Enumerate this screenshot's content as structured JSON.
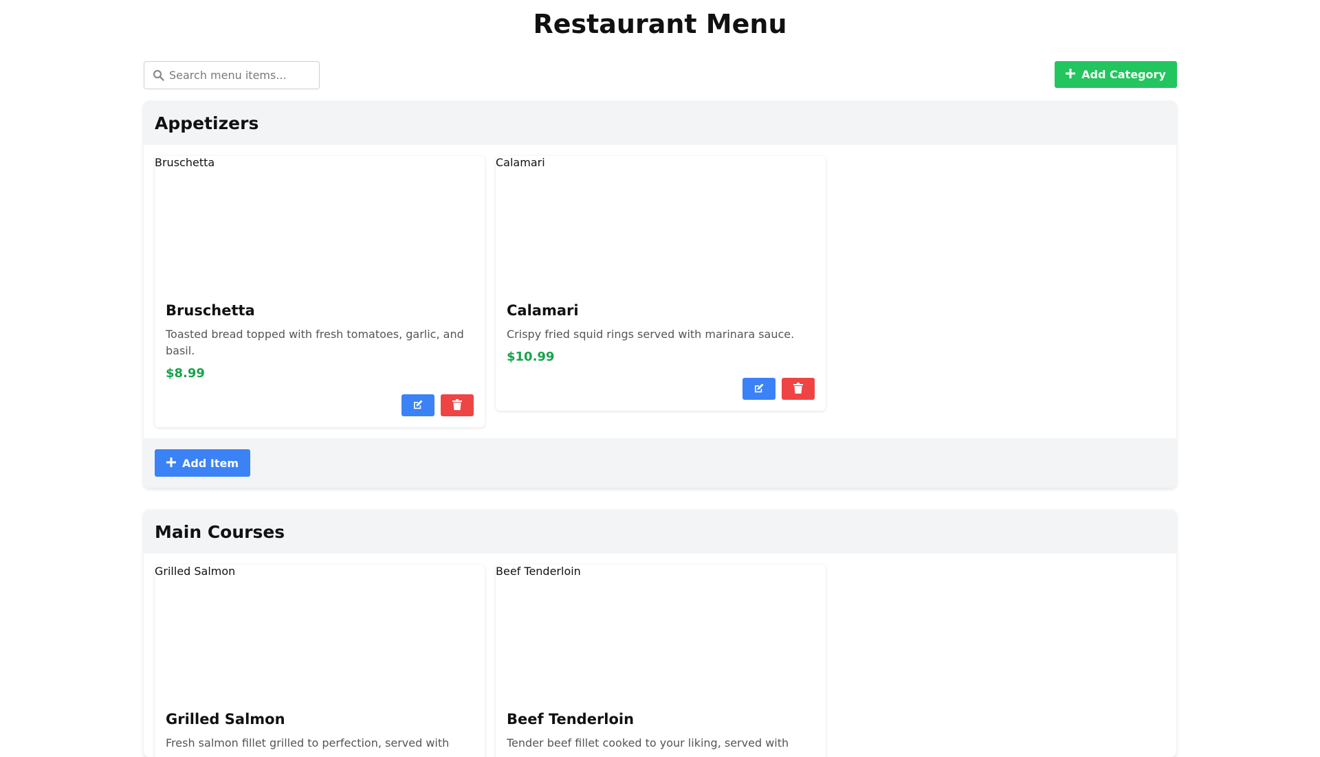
{
  "page": {
    "title": "Restaurant Menu"
  },
  "search": {
    "placeholder": "Search menu items...",
    "value": ""
  },
  "toolbar": {
    "add_category_label": "Add Category"
  },
  "colors": {
    "add_category": "#22c55e",
    "edit": "#3b82f6",
    "delete": "#ef4444",
    "price": "#16a34a",
    "section_bg": "#f3f4f6"
  },
  "categories": [
    {
      "name": "Appetizers",
      "add_item_label": "Add Item",
      "items": [
        {
          "name": "Bruschetta",
          "image_alt": "Bruschetta",
          "description": "Toasted bread topped with fresh tomatoes, garlic, and basil.",
          "price": "$8.99"
        },
        {
          "name": "Calamari",
          "image_alt": "Calamari",
          "description": "Crispy fried squid rings served with marinara sauce.",
          "price": "$10.99"
        }
      ]
    },
    {
      "name": "Main Courses",
      "items": [
        {
          "name": "Grilled Salmon",
          "image_alt": "Grilled Salmon",
          "description": "Fresh salmon fillet grilled to perfection, served with"
        },
        {
          "name": "Beef Tenderloin",
          "image_alt": "Beef Tenderloin",
          "description": "Tender beef fillet cooked to your liking, served with"
        }
      ]
    }
  ],
  "icons": {
    "search": "search-icon",
    "plus": "plus-icon",
    "edit": "edit-icon",
    "delete": "trash-icon"
  }
}
